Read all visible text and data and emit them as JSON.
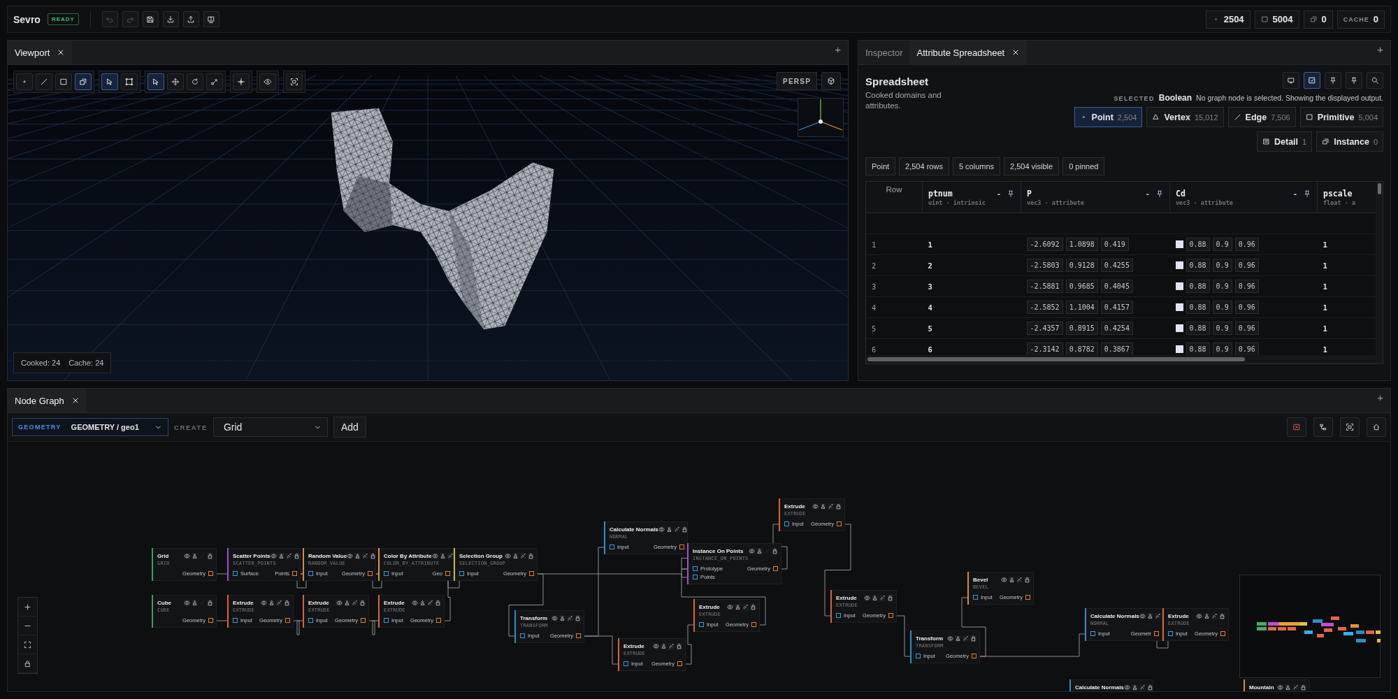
{
  "app": {
    "name": "Sevro",
    "status": "READY"
  },
  "toolbar": [
    {
      "kind": "undo",
      "disabled": true
    },
    {
      "kind": "redo",
      "disabled": true
    },
    {
      "kind": "save",
      "disabled": false
    },
    {
      "kind": "import",
      "disabled": false
    },
    {
      "kind": "export",
      "disabled": false
    },
    {
      "kind": "layout",
      "disabled": false
    }
  ],
  "stats": [
    {
      "kind": "point",
      "value": "2504"
    },
    {
      "kind": "face",
      "value": "5004"
    },
    {
      "kind": "object",
      "value": "0"
    },
    {
      "kind": "cache",
      "label": "CACHE",
      "value": "0"
    }
  ],
  "viewport": {
    "tab": "Viewport",
    "add": "+",
    "projection": "PERSP",
    "cooked": "Cooked: 24",
    "cache": "Cache: 24",
    "tool_groups": [
      [
        {
          "kind": "point",
          "selected": false
        },
        {
          "kind": "edge",
          "selected": false
        },
        {
          "kind": "face",
          "selected": false
        },
        {
          "kind": "object",
          "selected": true
        }
      ],
      [
        {
          "kind": "select",
          "selected": true
        },
        {
          "kind": "box-select",
          "selected": false
        }
      ],
      [
        {
          "kind": "select",
          "selected": true
        },
        {
          "kind": "move",
          "selected": false
        },
        {
          "kind": "rotate",
          "selected": false
        },
        {
          "kind": "scale",
          "selected": false
        }
      ],
      [
        {
          "kind": "snap",
          "selected": false
        }
      ],
      [
        {
          "kind": "visibility",
          "selected": false
        }
      ],
      [
        {
          "kind": "frame",
          "selected": false
        }
      ]
    ]
  },
  "inspector": {
    "add": "+",
    "tabs": [
      {
        "label": "Inspector",
        "selected": false,
        "closable": false
      },
      {
        "label": "Attribute Spreadsheet",
        "selected": true,
        "closable": true
      }
    ],
    "title": "Spreadsheet",
    "subtitle": "Cooked domains and attributes.",
    "tools": [
      {
        "kind": "monitor",
        "selected": false
      },
      {
        "kind": "checkbox",
        "selected": true
      },
      {
        "kind": "pin",
        "selected": false
      },
      {
        "kind": "pin",
        "selected": false
      },
      {
        "kind": "search",
        "selected": false
      }
    ],
    "selected_label": "SELECTED",
    "selected_value": "Boolean",
    "message": "No graph node is selected. Showing the displayed output.",
    "domains": [
      {
        "kind": "point",
        "label": "Point",
        "count": "2,504",
        "selected": true
      },
      {
        "kind": "vertex",
        "label": "Vertex",
        "count": "15,012",
        "selected": false
      },
      {
        "kind": "edge",
        "label": "Edge",
        "count": "7,506",
        "selected": false
      },
      {
        "kind": "face",
        "label": "Primitive",
        "count": "5,004",
        "selected": false
      },
      {
        "kind": "detail",
        "label": "Detail",
        "count": "1",
        "selected": false
      },
      {
        "kind": "object",
        "label": "Instance",
        "count": "0",
        "selected": false
      }
    ],
    "chips": [
      "Point",
      "2,504 rows",
      "5 columns",
      "2,504 visible",
      "0 pinned"
    ],
    "columns": [
      {
        "name": "Row"
      },
      {
        "name": "ptnum",
        "type": "uint · intrinsic",
        "menu": "-"
      },
      {
        "name": "P",
        "type": "vec3 · attribute",
        "menu": "-"
      },
      {
        "name": "Cd",
        "type": "vec3 · attribute",
        "menu": "-"
      },
      {
        "name": "pscale",
        "type": "float · a"
      }
    ],
    "rows": [
      {
        "row": "1",
        "ptnum": "1",
        "P": [
          "-2.6092",
          "1.0898",
          "0.419"
        ],
        "color": "#e2e4f4",
        "Cd": [
          "0.88",
          "0.9",
          "0.96"
        ],
        "pscale": "1"
      },
      {
        "row": "2",
        "ptnum": "2",
        "P": [
          "-2.5803",
          "0.9128",
          "0.4255"
        ],
        "color": "#e2e4f4",
        "Cd": [
          "0.88",
          "0.9",
          "0.96"
        ],
        "pscale": "1"
      },
      {
        "row": "3",
        "ptnum": "3",
        "P": [
          "-2.5881",
          "0.9685",
          "0.4045"
        ],
        "color": "#e2e4f4",
        "Cd": [
          "0.88",
          "0.9",
          "0.96"
        ],
        "pscale": "1"
      },
      {
        "row": "4",
        "ptnum": "4",
        "P": [
          "-2.5852",
          "1.1004",
          "0.4157"
        ],
        "color": "#e2e4f4",
        "Cd": [
          "0.88",
          "0.9",
          "0.96"
        ],
        "pscale": "1"
      },
      {
        "row": "5",
        "ptnum": "5",
        "P": [
          "-2.4357",
          "0.8915",
          "0.4254"
        ],
        "color": "#e2e4f4",
        "Cd": [
          "0.88",
          "0.9",
          "0.96"
        ],
        "pscale": "1"
      },
      {
        "row": "6",
        "ptnum": "6",
        "P": [
          "-2.3142",
          "0.8782",
          "0.3867"
        ],
        "color": "#e2e4f4",
        "Cd": [
          "0.88",
          "0.9",
          "0.96"
        ],
        "pscale": "1"
      }
    ]
  },
  "node_graph": {
    "tab": "Node Graph",
    "add": "+",
    "context_label": "GEOMETRY",
    "context": "GEOMETRY / geo1",
    "create_label": "CREATE",
    "create_value": "Grid",
    "add_button": "Add",
    "tools": [
      {
        "kind": "delete"
      },
      {
        "kind": "layout-tree"
      },
      {
        "kind": "frame"
      },
      {
        "kind": "home"
      }
    ],
    "nodes": [
      {
        "title": "Grid",
        "type": "GRID",
        "color": "#3f9d62",
        "link_disabled": true,
        "output": "Geometry"
      },
      {
        "title": "Scatter Points",
        "type": "SCATTER_POINTS",
        "color": "#a64fc9",
        "link_disabled": false,
        "inputs": [
          "Surface"
        ],
        "output": "Points"
      },
      {
        "title": "Random Value",
        "type": "RANDOM_VALUE",
        "color": "#d98a3a",
        "link_disabled": false,
        "inputs": [
          "Input"
        ],
        "output": "Geometry"
      },
      {
        "title": "Color By Attribute",
        "type": "COLOR_BY_ATTRIBUTE",
        "color": "#d9963a",
        "link_disabled": false,
        "inputs": [
          "Input"
        ],
        "output": "Geo"
      },
      {
        "title": "Selection Group",
        "type": "SELECTION_GROUP",
        "color": "#d4b43a",
        "link_disabled": false,
        "inputs": [
          "Input"
        ],
        "output": "Geometry"
      },
      {
        "title": "Cube",
        "type": "CUBE",
        "color": "#3f9d62",
        "link_disabled": true,
        "output": "Geometry"
      },
      {
        "title": "Extrude",
        "type": "EXTRUDE",
        "color": "#d9643a",
        "link_disabled": false,
        "inputs": [
          "Input"
        ],
        "output": "Geometry"
      },
      {
        "title": "Extrude",
        "type": "EXTRUDE",
        "color": "#d9643a",
        "link_disabled": false,
        "inputs": [
          "Input"
        ],
        "output": "Geometry"
      },
      {
        "title": "Extrude",
        "type": "EXTRUDE",
        "color": "#d9643a",
        "link_disabled": false,
        "inputs": [
          "Input"
        ],
        "output": "Geometry"
      },
      {
        "title": "Transform",
        "type": "TRANSFORM",
        "color": "#2f8fc0",
        "link_disabled": false,
        "inputs": [
          "Input"
        ],
        "output": "Geometry"
      },
      {
        "title": "Calculate Normals",
        "type": "NORMAL",
        "color": "#2f8fc0",
        "link_disabled": false,
        "inputs": [
          "Input"
        ],
        "output": "Geometry"
      },
      {
        "title": "Instance On Points",
        "type": "INSTANCE_ON_POINTS",
        "color": "#a64fc9",
        "link_disabled": true,
        "inputs": [
          "Prototype",
          "Points"
        ],
        "output": "Geometry"
      },
      {
        "title": "Extrude",
        "type": "EXTRUDE",
        "color": "#d9643a",
        "link_disabled": false,
        "inputs": [
          "Input"
        ],
        "output": "Geometry"
      },
      {
        "title": "Extrude",
        "type": "EXTRUDE",
        "color": "#d9643a",
        "link_disabled": false,
        "inputs": [
          "Input"
        ],
        "output": "Geometry"
      },
      {
        "title": "Extrude",
        "type": "EXTRUDE",
        "color": "#d9643a",
        "link_disabled": false,
        "inputs": [
          "Input"
        ],
        "output": "Geometry"
      },
      {
        "title": "Extrude",
        "type": "EXTRUDE",
        "color": "#d9643a",
        "link_disabled": false,
        "inputs": [
          "Input"
        ],
        "output": "Geometry"
      },
      {
        "title": "Transform",
        "type": "TRANSFORM",
        "color": "#2f8fc0",
        "link_disabled": false,
        "inputs": [
          "Input"
        ],
        "output": "Geometry"
      },
      {
        "title": "Bevel",
        "type": "BEVEL",
        "color": "#d98a3a",
        "link_disabled": false,
        "inputs": [
          "Input"
        ],
        "output": "Geometry"
      },
      {
        "title": "Calculate Normals",
        "type": "NORMAL",
        "color": "#2f8fc0",
        "link_disabled": false,
        "inputs": [
          "Input"
        ],
        "output": "Geometr"
      },
      {
        "title": "Extrude",
        "type": "EXTRUDE",
        "color": "#d9643a",
        "link_disabled": false,
        "inputs": [
          "Input"
        ],
        "output": "Geometry"
      },
      {
        "title": "Calculate Normals",
        "color": "#2f8fc0",
        "link_disabled": false
      },
      {
        "title": "Mountain",
        "color": "#d98a3a",
        "link_disabled": false
      }
    ]
  }
}
